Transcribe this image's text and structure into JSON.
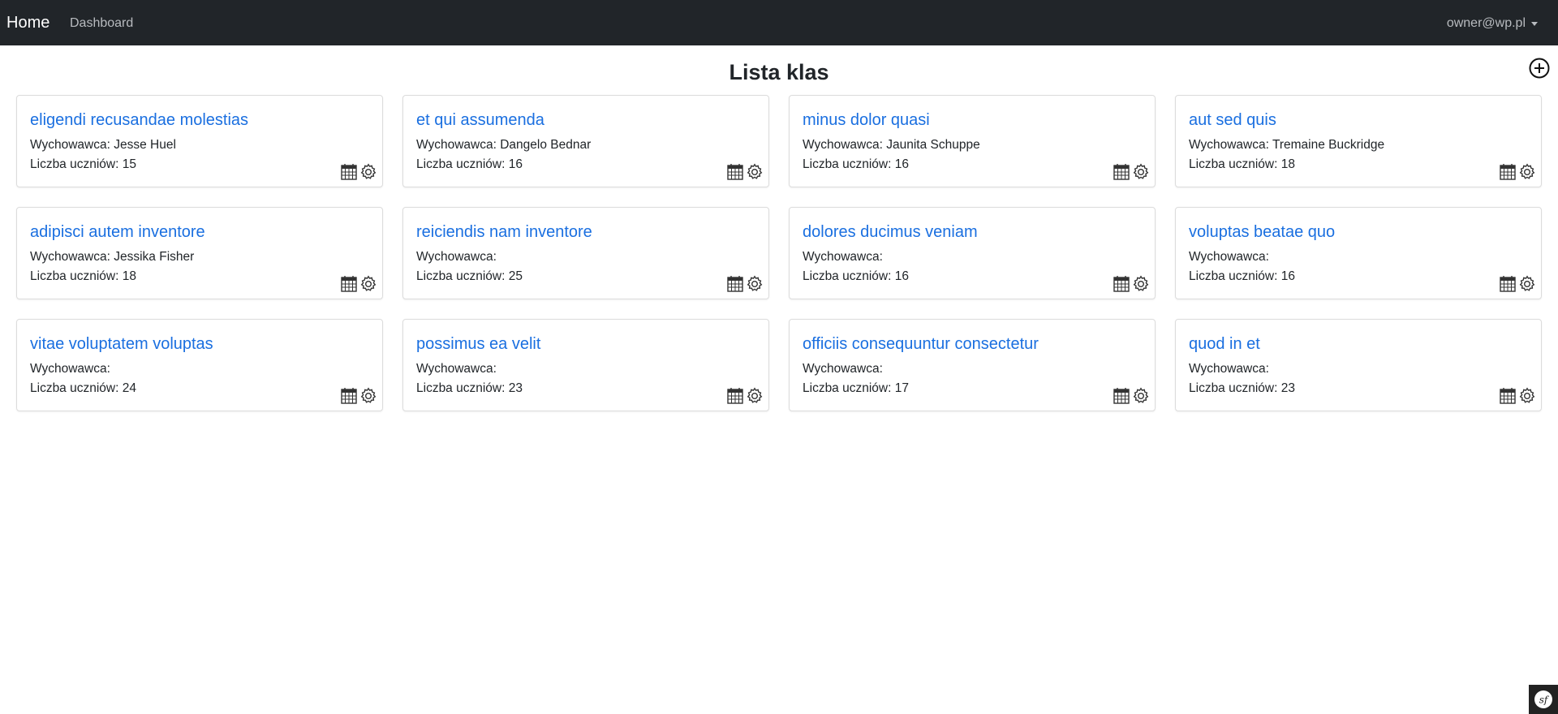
{
  "navbar": {
    "brand": "Home",
    "link_dashboard": "Dashboard",
    "user": "owner@wp.pl"
  },
  "page": {
    "title": "Lista klas",
    "add_icon": "plus-circle-icon"
  },
  "labels": {
    "teacher": "Wychowawca:",
    "count": "Liczba uczniów:"
  },
  "classes": [
    {
      "name": "eligendi recusandae molestias",
      "teacher": "Jesse Huel",
      "students": "15"
    },
    {
      "name": "et qui assumenda",
      "teacher": "Dangelo Bednar",
      "students": "16"
    },
    {
      "name": "minus dolor quasi",
      "teacher": "Jaunita Schuppe",
      "students": "16"
    },
    {
      "name": "aut sed quis",
      "teacher": "Tremaine Buckridge",
      "students": "18"
    },
    {
      "name": "adipisci autem inventore",
      "teacher": "Jessika Fisher",
      "students": "18"
    },
    {
      "name": "reiciendis nam inventore",
      "teacher": "",
      "students": "25"
    },
    {
      "name": "dolores ducimus veniam",
      "teacher": "",
      "students": "16"
    },
    {
      "name": "voluptas beatae quo",
      "teacher": "",
      "students": "16"
    },
    {
      "name": "vitae voluptatem voluptas",
      "teacher": "",
      "students": "24"
    },
    {
      "name": "possimus ea velit",
      "teacher": "",
      "students": "23"
    },
    {
      "name": "officiis consequuntur consectetur",
      "teacher": "",
      "students": "17"
    },
    {
      "name": "quod in et",
      "teacher": "",
      "students": "23"
    }
  ],
  "colors": {
    "navbar_bg": "#212529",
    "link": "#1a6fe0"
  }
}
